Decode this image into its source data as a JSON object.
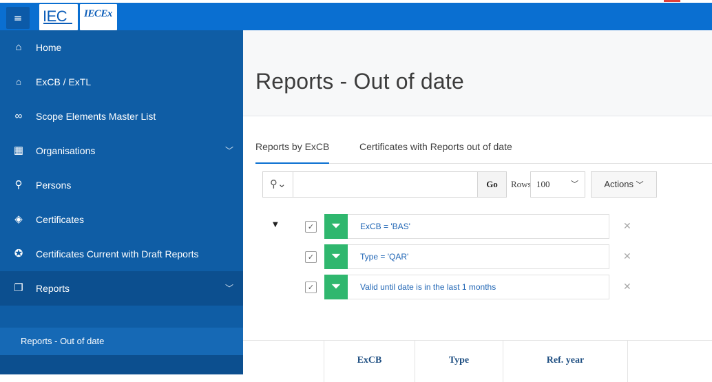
{
  "header": {
    "menu_icon": "hamburger-icon",
    "logo_text": "IEC",
    "logo_ex_text": "IECEx"
  },
  "sidebar": {
    "items": [
      {
        "icon": "home-icon",
        "glyph": "⌂",
        "label": "Home"
      },
      {
        "icon": "bank-icon",
        "glyph": "🏛",
        "label": "ExCB / ExTL"
      },
      {
        "icon": "share-nodes-icon",
        "glyph": "∞",
        "label": "Scope Elements Master List"
      },
      {
        "icon": "building-icon",
        "glyph": "▦",
        "label": "Organisations"
      },
      {
        "icon": "persons-icon",
        "glyph": "⚲",
        "label": "Persons"
      },
      {
        "icon": "graduation-cap-icon",
        "glyph": "◈",
        "label": "Certificates"
      },
      {
        "icon": "badge-icon",
        "glyph": "✪",
        "label": "Certificates Current with Draft Reports"
      },
      {
        "icon": "copy-icon",
        "glyph": "❐",
        "label": "Reports"
      }
    ],
    "subitem": "Reports - Out of date"
  },
  "page": {
    "title": "Reports - Out of date"
  },
  "tabs": [
    "Reports by ExCB",
    "Certificates with Reports out of date"
  ],
  "toolbar": {
    "search_placeholder": "",
    "go_label": "Go",
    "rows_label": "Rows",
    "rows_value": "100",
    "actions_label": "Actions"
  },
  "filters": [
    {
      "text": "ExCB = 'BAS'",
      "checked": true
    },
    {
      "text": "Type = 'QAR'",
      "checked": true
    },
    {
      "text": "Valid until date is in the last 1 months",
      "checked": true
    }
  ],
  "grid": {
    "columns": [
      "ExCB",
      "Type",
      "Ref. year"
    ]
  }
}
